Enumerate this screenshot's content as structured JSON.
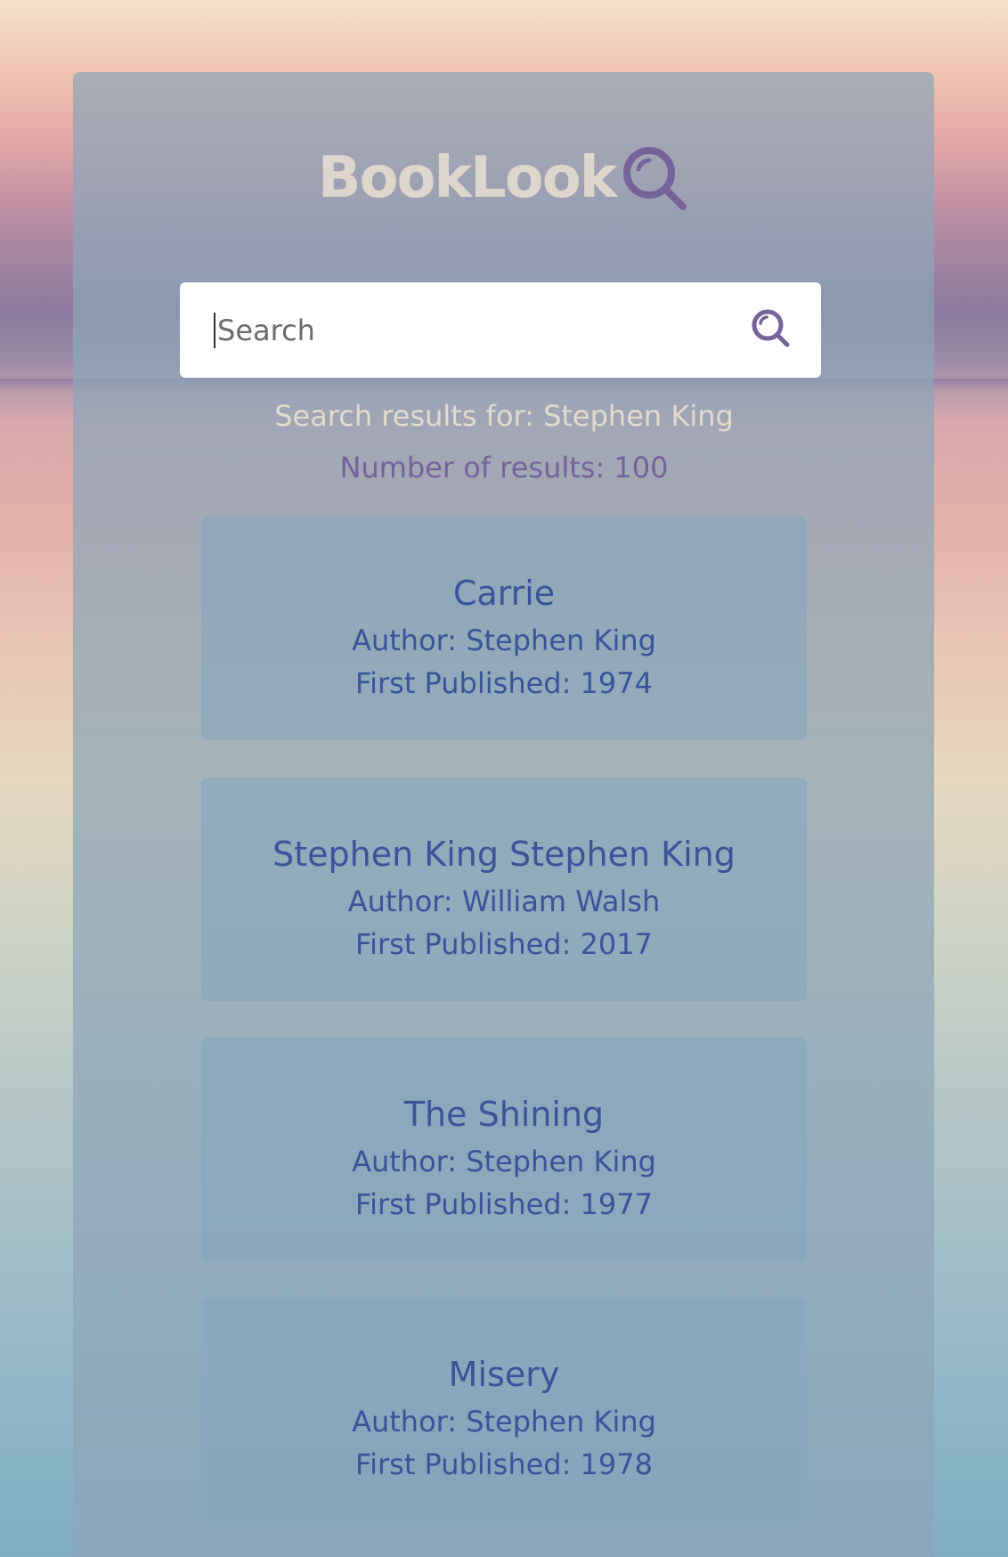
{
  "app": {
    "title": "BookLook",
    "logo_icon": "magnifier-icon"
  },
  "search": {
    "placeholder": "Search",
    "value": "",
    "button_icon": "search-icon"
  },
  "results": {
    "title": "Search results for: Stephen King",
    "count": "Number of results: 100"
  },
  "books": [
    {
      "title": "Carrie",
      "author": "Author: Stephen King",
      "first_published": "First Published: 1974"
    },
    {
      "title": "Stephen King Stephen King",
      "author": "Author: William Walsh",
      "first_published": "First Published: 2017"
    },
    {
      "title": "The Shining",
      "author": "Author: Stephen King",
      "first_published": "First Published: 1977"
    },
    {
      "title": "Misery",
      "author": "Author: Stephen King",
      "first_published": "First Published: 1978"
    }
  ],
  "colors": {
    "logo_text": "#ddd6cc",
    "accent": "#75639a",
    "card_text": "#3a5499"
  }
}
